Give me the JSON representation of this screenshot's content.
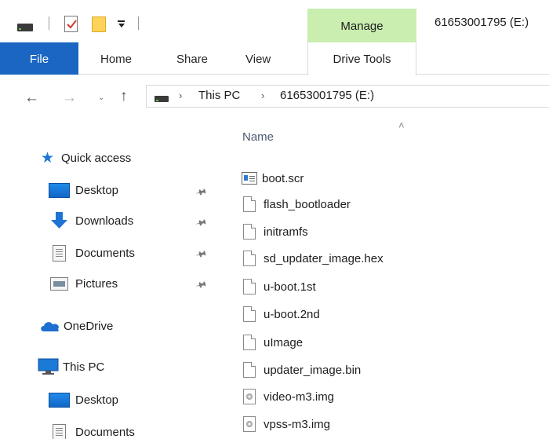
{
  "window": {
    "title": "61653001795 (E:)",
    "context_tab": "Manage",
    "context_tab_color": "#c9eeaf"
  },
  "quick_access_toolbar": {
    "icons": [
      "drive-icon",
      "properties-icon",
      "new-folder-icon",
      "customize-toolbar-icon"
    ]
  },
  "ribbon": {
    "accent": "#1a66c2",
    "tabs": [
      {
        "label": "File",
        "active": true
      },
      {
        "label": "Home"
      },
      {
        "label": "Share"
      },
      {
        "label": "View"
      },
      {
        "label": "Drive Tools"
      }
    ]
  },
  "address_bar": {
    "breadcrumb": [
      "This PC",
      "61653001795 (E:)"
    ]
  },
  "navigation_pane": {
    "items": [
      {
        "label": "Quick access",
        "icon": "star-icon",
        "pinned": false
      },
      {
        "label": "Desktop",
        "icon": "desktop-icon",
        "pinned": true
      },
      {
        "label": "Downloads",
        "icon": "downloads-icon",
        "pinned": true
      },
      {
        "label": "Documents",
        "icon": "documents-icon",
        "pinned": true
      },
      {
        "label": "Pictures",
        "icon": "pictures-icon",
        "pinned": true
      },
      {
        "label": "OneDrive",
        "icon": "onedrive-icon",
        "pinned": false
      },
      {
        "label": "This PC",
        "icon": "this-pc-icon",
        "pinned": false
      },
      {
        "label": "Desktop",
        "icon": "desktop-icon",
        "pinned": false
      },
      {
        "label": "Documents",
        "icon": "documents-icon",
        "pinned": false
      }
    ]
  },
  "file_list": {
    "column_name": "Name",
    "files": [
      {
        "name": "boot.scr",
        "icon": "script-file-icon"
      },
      {
        "name": "flash_bootloader",
        "icon": "file-icon"
      },
      {
        "name": "initramfs",
        "icon": "file-icon"
      },
      {
        "name": "sd_updater_image.hex",
        "icon": "file-icon"
      },
      {
        "name": "u-boot.1st",
        "icon": "file-icon"
      },
      {
        "name": "u-boot.2nd",
        "icon": "file-icon"
      },
      {
        "name": "uImage",
        "icon": "file-icon"
      },
      {
        "name": "updater_image.bin",
        "icon": "file-icon"
      },
      {
        "name": "video-m3.img",
        "icon": "disc-image-icon"
      },
      {
        "name": "vpss-m3.img",
        "icon": "disc-image-icon"
      }
    ]
  }
}
